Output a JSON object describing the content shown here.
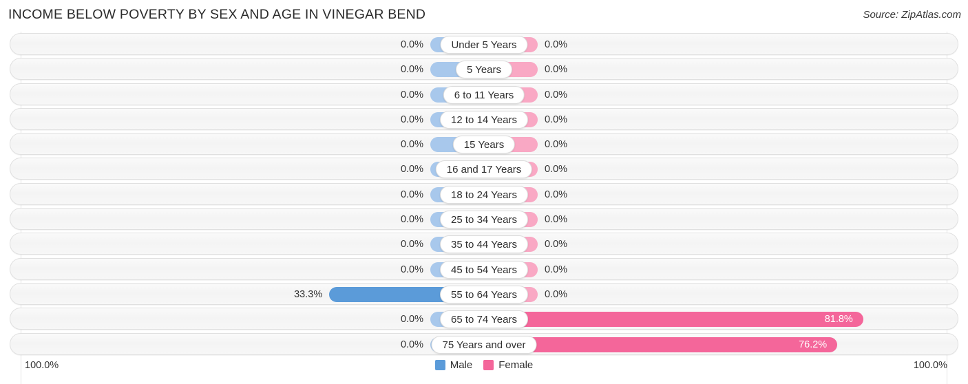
{
  "header": {
    "title": "INCOME BELOW POVERTY BY SEX AND AGE IN VINEGAR BEND",
    "source": "Source: ZipAtlas.com"
  },
  "axis": {
    "left_label": "100.0%",
    "right_label": "100.0%",
    "max": 100.0
  },
  "legend": {
    "items": [
      {
        "label": "Male",
        "color": "#5b9bd9"
      },
      {
        "label": "Female",
        "color": "#f4669a"
      }
    ]
  },
  "colors": {
    "male_zero": "#a8c8ec",
    "female_zero": "#f9a8c4",
    "male": "#5b9bd9",
    "female": "#f4669a",
    "track": "#f5f5f5"
  },
  "chart_data": {
    "type": "bar",
    "title": "INCOME BELOW POVERTY BY SEX AND AGE IN VINEGAR BEND",
    "xlabel": "",
    "ylabel": "",
    "xlim": [
      0,
      100
    ],
    "grid": true,
    "legend_position": "bottom-center",
    "orientation": "horizontal-diverging",
    "categories": [
      "Under 5 Years",
      "5 Years",
      "6 to 11 Years",
      "12 to 14 Years",
      "15 Years",
      "16 and 17 Years",
      "18 to 24 Years",
      "25 to 34 Years",
      "35 to 44 Years",
      "45 to 54 Years",
      "55 to 64 Years",
      "65 to 74 Years",
      "75 Years and over"
    ],
    "series": [
      {
        "name": "Male",
        "values": [
          0.0,
          0.0,
          0.0,
          0.0,
          0.0,
          0.0,
          0.0,
          0.0,
          0.0,
          0.0,
          33.3,
          0.0,
          0.0
        ]
      },
      {
        "name": "Female",
        "values": [
          0.0,
          0.0,
          0.0,
          0.0,
          0.0,
          0.0,
          0.0,
          0.0,
          0.0,
          0.0,
          0.0,
          81.8,
          76.2
        ]
      }
    ],
    "male_labels": [
      "0.0%",
      "0.0%",
      "0.0%",
      "0.0%",
      "0.0%",
      "0.0%",
      "0.0%",
      "0.0%",
      "0.0%",
      "0.0%",
      "33.3%",
      "0.0%",
      "0.0%"
    ],
    "female_labels": [
      "0.0%",
      "0.0%",
      "0.0%",
      "0.0%",
      "0.0%",
      "0.0%",
      "0.0%",
      "0.0%",
      "0.0%",
      "0.0%",
      "0.0%",
      "81.8%",
      "76.2%"
    ]
  }
}
